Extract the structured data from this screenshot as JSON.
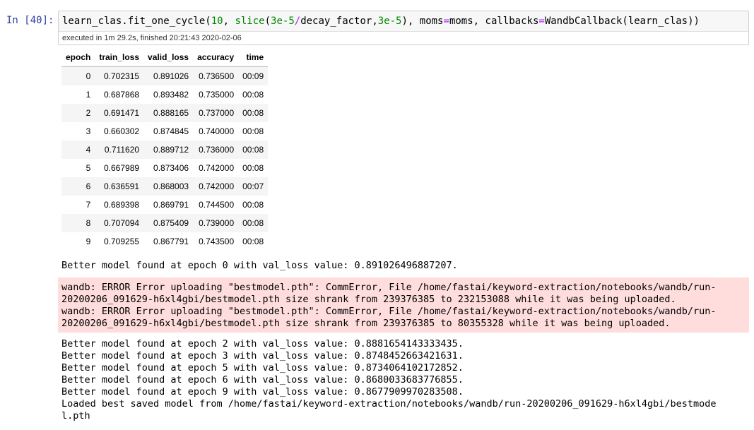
{
  "cell": {
    "prompt": "In [40]:",
    "code_parts": {
      "a": "learn_clas.fit_one_cycle(",
      "b": "10",
      "c": ", ",
      "d": "slice",
      "e": "(",
      "f": "3e-5",
      "g": "/",
      "h": "decay_factor,",
      "i": "3e-5",
      "j": "), moms",
      "k": "=",
      "l": "moms, callbacks",
      "m": "=",
      "n": "WandbCallback(learn_clas))"
    },
    "exec_info": "executed in 1m 29.2s, finished 20:21:43 2020-02-06"
  },
  "table": {
    "headers": [
      "epoch",
      "train_loss",
      "valid_loss",
      "accuracy",
      "time"
    ],
    "rows": [
      [
        "0",
        "0.702315",
        "0.891026",
        "0.736500",
        "00:09"
      ],
      [
        "1",
        "0.687868",
        "0.893482",
        "0.735000",
        "00:08"
      ],
      [
        "2",
        "0.691471",
        "0.888165",
        "0.737000",
        "00:08"
      ],
      [
        "3",
        "0.660302",
        "0.874845",
        "0.740000",
        "00:08"
      ],
      [
        "4",
        "0.711620",
        "0.889712",
        "0.736000",
        "00:08"
      ],
      [
        "5",
        "0.667989",
        "0.873406",
        "0.742000",
        "00:08"
      ],
      [
        "6",
        "0.636591",
        "0.868003",
        "0.742000",
        "00:07"
      ],
      [
        "7",
        "0.689398",
        "0.869791",
        "0.744500",
        "00:08"
      ],
      [
        "8",
        "0.707094",
        "0.875409",
        "0.739000",
        "00:08"
      ],
      [
        "9",
        "0.709255",
        "0.867791",
        "0.743500",
        "00:08"
      ]
    ]
  },
  "stdout_first": "Better model found at epoch 0 with val_loss value: 0.891026496887207.",
  "stderr_lines": [
    "wandb: ERROR Error uploading \"bestmodel.pth\": CommError, File /home/fastai/keyword-extraction/notebooks/wandb/run-",
    "20200206_091629-h6xl4gbi/bestmodel.pth size shrank from 239376385 to 232153088 while it was being uploaded.",
    "wandb: ERROR Error uploading \"bestmodel.pth\": CommError, File /home/fastai/keyword-extraction/notebooks/wandb/run-",
    "20200206_091629-h6xl4gbi/bestmodel.pth size shrank from 239376385 to 80355328 while it was being uploaded."
  ],
  "stdout_lines": [
    "Better model found at epoch 2 with val_loss value: 0.8881654143333435.",
    "Better model found at epoch 3 with val_loss value: 0.8748452663421631.",
    "Better model found at epoch 5 with val_loss value: 0.8734064102172852.",
    "Better model found at epoch 6 with val_loss value: 0.8680033683776855.",
    "Better model found at epoch 9 with val_loss value: 0.8677909970283508.",
    "Loaded best saved model from /home/fastai/keyword-extraction/notebooks/wandb/run-20200206_091629-h6xl4gbi/bestmode",
    "l.pth"
  ],
  "colors": {
    "prompt": "#303f9f",
    "error_bg": "#ffdddd",
    "number": "#008800",
    "operator": "#aa22ff"
  }
}
